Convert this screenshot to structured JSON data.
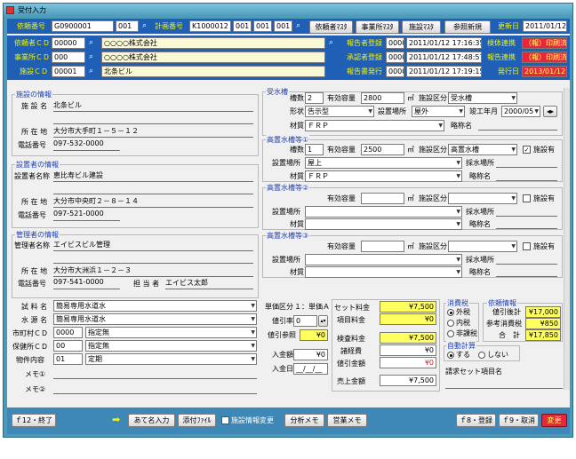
{
  "window": {
    "title": "受付入力"
  },
  "header": {
    "row1": {
      "label_receipt_no": "依頼番号",
      "receipt_no": "G0900001",
      "receipt_sub": "001",
      "label_plan_no": "計画番号",
      "plan_no": "K1000012",
      "plan_sub1": "001",
      "plan_sub2": "001",
      "plan_sub3": "001",
      "btn_requester_master": "依頼者ﾏｽﾀ",
      "btn_office_master": "事業所ﾏｽﾀ",
      "btn_facility_master": "施設ﾏｽﾀ",
      "btn_reference_new": "参照新規",
      "label_updated": "更新日",
      "updated": "2011/01/12"
    },
    "row2": {
      "label": "依頼者ＣＤ",
      "code": "00000",
      "name": "○○○○株式会社",
      "label_report_reg": "報告者登録",
      "report_reg_user": "0000",
      "report_reg_time": "2011/01/12 17:16:35",
      "label_result_linked": "検体連携",
      "result_linked": "（報）印刷済"
    },
    "row3": {
      "label": "事業所ＣＤ",
      "code": "000",
      "name": "○○○○株式会社",
      "label_approver_reg": "承認者登録",
      "approver_reg_user": "0000",
      "approver_reg_time": "2011/01/12 17:48:57",
      "label_report_linked": "報告連携",
      "report_linked": "（報）印刷済"
    },
    "row4": {
      "label": "施設ＣＤ",
      "code": "00001",
      "name": "北条ビル",
      "label_report_issue": "報告書発行",
      "report_issue_user": "0000",
      "report_issue_time": "2011/01/12 17:19:15",
      "label_issue_date": "発行日",
      "issue_date": "2013/01/12"
    }
  },
  "facility": {
    "group_title": "施設の情報",
    "label_name": "施 設 名",
    "name": "北条ビル",
    "label_address": "所 在 地",
    "address": "大分市大手町１－５－１２",
    "label_phone": "電話番号",
    "phone": "097-532-0000"
  },
  "installer": {
    "group_title": "設置者の情報",
    "label_name": "設置者名称",
    "name": "恵比寿ビル建設",
    "label_address": "所 在 地",
    "address": "大分市中央町２－８－１４",
    "label_phone": "電話番号",
    "phone": "097-521-0000"
  },
  "manager": {
    "group_title": "管理者の情報",
    "label_name": "管理者名称",
    "name": "エイビスビル管理",
    "label_address": "所 在 地",
    "address": "大分市大洲浜１－２－３",
    "label_phone": "電話番号",
    "phone": "097-541-0000",
    "label_person": "担 当 者",
    "person": "エイビス太郎"
  },
  "sample": {
    "label_sample_name": "試 料 名",
    "sample_name": "簡易専用水道水",
    "label_source": "水 源 名",
    "source": "簡易専用水道水",
    "label_city_cd": "市町村ＣＤ",
    "city_code": "0000",
    "city_name": "指定無",
    "label_health_cd": "保健所ＣＤ",
    "health_code": "00",
    "health_name": "指定無",
    "label_property": "物件内容",
    "property_code": "01",
    "property_name": "定期",
    "label_memo1": "メモ①",
    "label_memo2": "メモ②"
  },
  "tank": {
    "group_title": "受水槽",
    "label_count": "槽数",
    "count": "2",
    "label_capacity": "有効容量",
    "capacity": "2800",
    "capacity_unit": "㎥",
    "label_kind": "施設区分",
    "kind": "受水槽",
    "label_shape": "形状",
    "shape": "告示型",
    "label_location": "設置場所",
    "location": "屋外",
    "label_completion": "竣工年月",
    "completion": "2000/05",
    "label_material": "材質",
    "material": "ＦＲＰ",
    "label_abbr": "略称名"
  },
  "elevated1": {
    "group_title": "高置水槽等①",
    "label_count": "槽数",
    "count": "1",
    "label_capacity": "有効容量",
    "capacity": "2500",
    "capacity_unit": "㎥",
    "label_kind": "施設区分",
    "kind": "高置水槽",
    "label_has": "施設有",
    "has": "✓",
    "label_location": "設置場所",
    "location": "屋上",
    "label_intake": "採水場所",
    "label_material": "材質",
    "material": "ＦＲＰ",
    "label_abbr": "略称名"
  },
  "elevated2": {
    "group_title": "高置水槽等②",
    "label_capacity": "有効容量",
    "capacity_unit": "㎥",
    "label_kind": "施設区分",
    "label_has": "施設有",
    "label_location": "設置場所",
    "label_intake": "採水場所",
    "label_material": "材質",
    "label_abbr": "略称名"
  },
  "elevated3": {
    "group_title": "高置水槽等③",
    "label_capacity": "有効容量",
    "capacity_unit": "㎥",
    "label_kind": "施設区分",
    "label_has": "施設有",
    "label_location": "設置場所",
    "label_intake": "採水場所",
    "label_material": "材質",
    "label_abbr": "略称名"
  },
  "pricing": {
    "label_unit_type": "単価区分",
    "unit_type": "１：単価Ａ",
    "label_discount_rate": "値引率",
    "discount_rate": "0",
    "label_discount_ref": "値引参照",
    "discount_ref": "¥0",
    "label_deposit": "入金額",
    "deposit": "¥0",
    "label_deposit_date": "入金日",
    "deposit_date": "__/__/__",
    "label_set_fee": "セット料金",
    "set_fee": "¥7,500",
    "label_item_fee": "項目料金",
    "item_fee": "¥0",
    "label_test_fee": "検査料金",
    "test_fee": "¥7,500",
    "label_misc_fee": "諸経費",
    "misc_fee": "¥0",
    "label_discount_amt": "値引金額",
    "discount_amt": "¥0",
    "label_sales": "売上金額",
    "sales": "¥7,500",
    "tax_title": "消費税",
    "tax_opt1": "外税",
    "tax_opt2": "内税",
    "tax_opt3": "非課税",
    "auto_title": "自動計算",
    "auto_opt1": "する",
    "auto_opt2": "しない",
    "label_set_item_name": "請求セット項目名",
    "billing_title": "依頼情報",
    "label_pre_discount": "値引後計",
    "pre_discount": "¥17,000",
    "label_ref_tax": "参考消費税",
    "ref_tax": "¥850",
    "label_total": "合　計",
    "total": "¥17,850"
  },
  "footer": {
    "f12": "ｆ12・終了",
    "address_input": "あて名入力",
    "attach_file": "添付ﾌｧｲﾙ",
    "facility_change": "施設情報変更",
    "analysis_memo": "分析メモ",
    "sales_memo": "営業メモ",
    "f8": "ｆ8・登録",
    "f9": "ｆ9・取消",
    "change": "変更"
  }
}
